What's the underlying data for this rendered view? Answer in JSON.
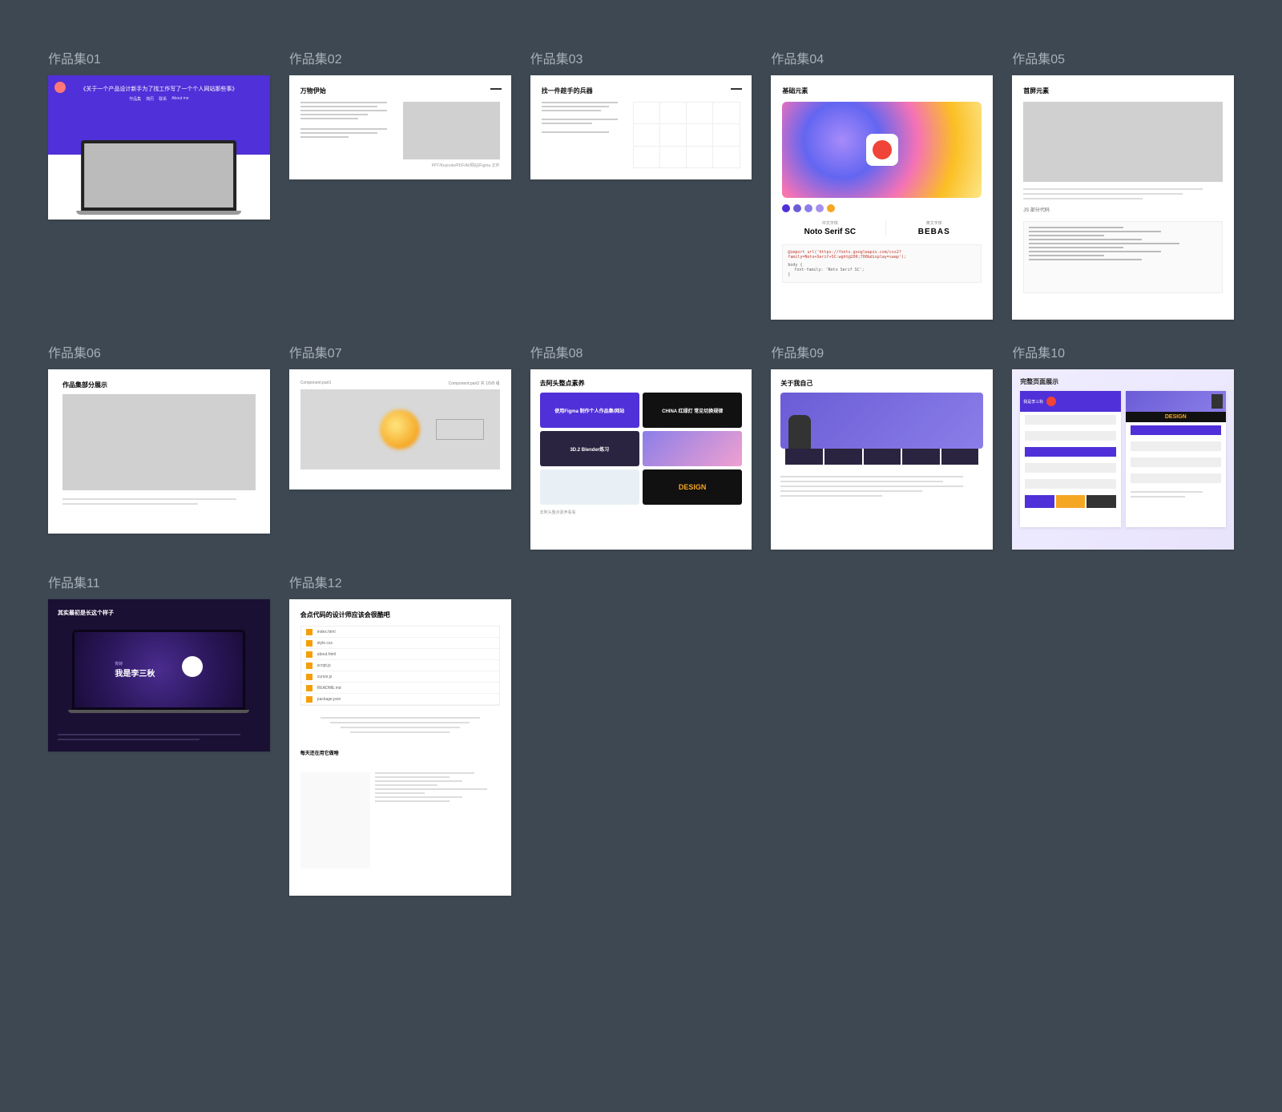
{
  "items": [
    {
      "label": "作品集01",
      "title": "《关于一个产品设计新手为了找工作写了一个个人网站那些事》",
      "nav": [
        "作品集",
        "简历",
        "联系",
        "About me"
      ]
    },
    {
      "label": "作品集02",
      "title": "万物伊始"
    },
    {
      "label": "作品集03",
      "title": "找一件趁手的兵器"
    },
    {
      "label": "作品集04",
      "title": "基础元素",
      "font1_cap": "中文字体",
      "font1": "Noto Serif SC",
      "font2_cap": "英文字体",
      "font2": "BEBAS",
      "code_import": "@import url('https://fonts.googleapis.com/css2?family=Noto+Serif+SC:wght@200;700&display=swap');",
      "code_font": "font-family: 'Noto Serif SC';",
      "dots": [
        "#5030d8",
        "#6b5cd6",
        "#8b7ee8",
        "#a590f0",
        "#f5a623"
      ]
    },
    {
      "label": "作品集05",
      "title": "首屏元素",
      "subtitle": "JS 部分代码"
    },
    {
      "label": "作品集06",
      "title": "作品集部分展示"
    },
    {
      "label": "作品集07",
      "title": "",
      "meta1": "Component:part1",
      "meta2": "Component:part2  共 1/5/8 组"
    },
    {
      "label": "作品集08",
      "title": "去阿头整点素养",
      "cards": [
        {
          "text": "使用Figma\n制作个人作品集/网站",
          "bg": "#5030d8"
        },
        {
          "text": "CHINA\n红绿灯\n常见切换规律",
          "bg": "#111"
        },
        {
          "text": "3D.2\nBlender练习",
          "bg": "#2a2440"
        },
        {
          "text": "",
          "bg": "linear-gradient(135deg,#8b7ee8,#f0a0d0)"
        },
        {
          "text": "",
          "bg": "#e8f0f5"
        },
        {
          "text": "DESIGN",
          "bg": "#111"
        }
      ]
    },
    {
      "label": "作品集09",
      "title": "关于我自己"
    },
    {
      "label": "作品集10",
      "title": "完整页面展示",
      "hero_text": "我是李三秋",
      "badge": "DESIGN"
    },
    {
      "label": "作品集11",
      "title": "其实最初是长这个样子",
      "hero_prefix": "你好",
      "hero_text": "我是李三秋"
    },
    {
      "label": "作品集12",
      "title": "会点代码的设计师应该会很酷吧",
      "subtitle": "每天还在用它做啥",
      "files": [
        "index.html",
        "style.css",
        "about.html",
        "script.js",
        "cursor.js",
        "README.md",
        "package.json"
      ]
    }
  ]
}
